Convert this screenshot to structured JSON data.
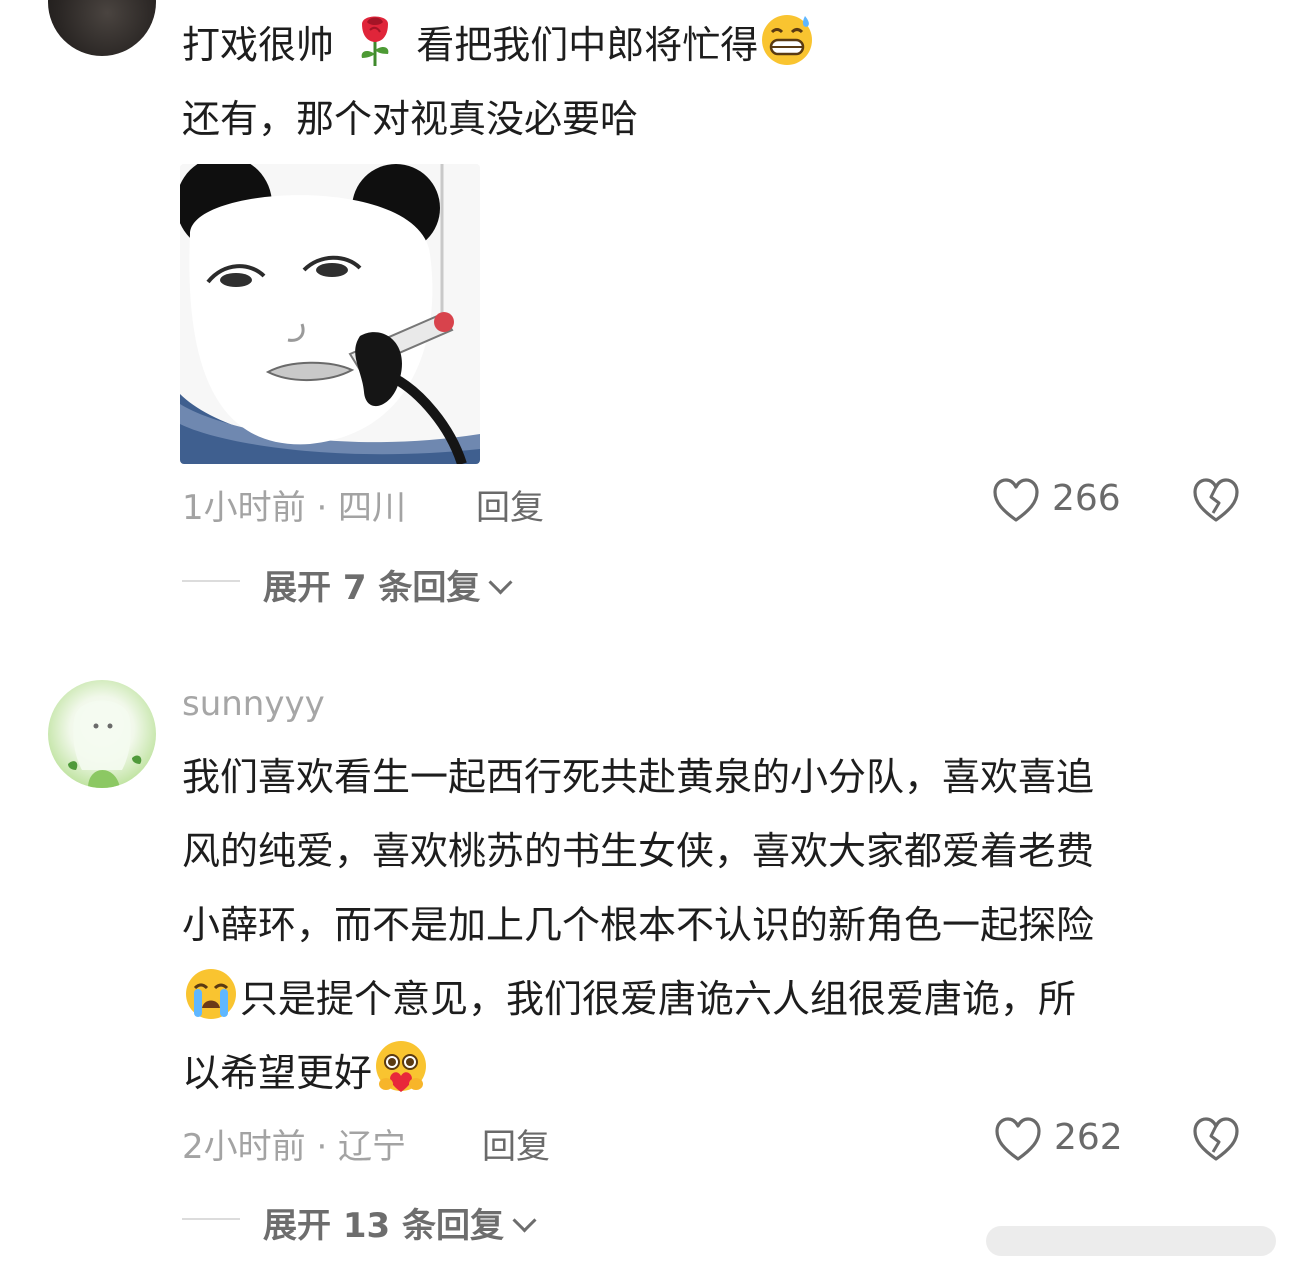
{
  "comments": [
    {
      "username": "",
      "text_line1": "打戏很帅",
      "text_line1_mid": "看把我们中郎将忙得",
      "text_line2": "还有，那个对视真没必要哈",
      "emoji_1": "rose-emoji",
      "emoji_2": "grinning-sweat-emoji",
      "image": "panda-meme-image",
      "time_location": "1小时前 · 四川",
      "reply_label": "回复",
      "likes": "266",
      "expand_label": "展开 7 条回复"
    },
    {
      "username": "sunnyyy",
      "text_lines": [
        "我们喜欢看生一起西行死共赴黄泉的小分队，喜欢喜追",
        "风的纯爱，喜欢桃苏的书生女侠，喜欢大家都爱着老费",
        "小薛环，而不是加上几个根本不认识的新角色一起探险"
      ],
      "line4_text": "只是提个意见，我们很爱唐诡六人组很爱唐诡，所",
      "line5_text": "以希望更好",
      "emoji_1": "loudly-crying-emoji",
      "emoji_2": "hugging-heart-emoji",
      "time_location": "2小时前 · 辽宁",
      "reply_label": "回复",
      "likes": "262",
      "expand_label": "展开 13 条回复"
    }
  ],
  "icons": {
    "like": "heart-outline-icon",
    "dislike": "broken-heart-icon",
    "expand": "chevron-down-icon"
  },
  "colors": {
    "text": "#1d1d1d",
    "meta": "#a3a3a3",
    "action": "#6a6a6a"
  }
}
